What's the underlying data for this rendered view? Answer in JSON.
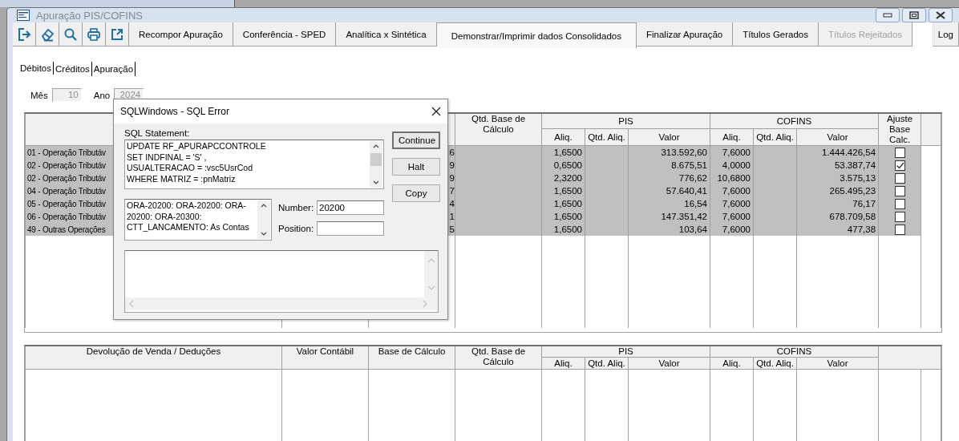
{
  "window": {
    "title": "Apuração PIS/COFINS"
  },
  "toolbar": [
    {
      "label": "Recompor Apuração",
      "selected": false,
      "disabled": false
    },
    {
      "label": "Conferência - SPED",
      "selected": false,
      "disabled": false
    },
    {
      "label": "Analítica x Sintética",
      "selected": false,
      "disabled": false
    },
    {
      "label": "Demonstrar/Imprimir dados Consolidados",
      "selected": true,
      "disabled": false
    },
    {
      "label": "Finalizar Apuração",
      "selected": false,
      "disabled": false
    },
    {
      "label": "Títulos Gerados",
      "selected": false,
      "disabled": false
    },
    {
      "label": "Títulos Rejeitados",
      "selected": false,
      "disabled": true
    }
  ],
  "log_button": "Log",
  "tabs": [
    {
      "label": "Débitos",
      "selected": true
    },
    {
      "label": "Créditos",
      "selected": false
    },
    {
      "label": "Apuração",
      "selected": false
    }
  ],
  "period": {
    "month_label": "Mês",
    "month": "10",
    "year_label": "Ano",
    "year": "2024"
  },
  "debits_table": {
    "header": {
      "qtd_base": "Qtd. Base de Cálculo",
      "pis": "PIS",
      "cofins": "COFINS",
      "pis_aliq": "Aliq.",
      "pis_qtd_aliq": "Qtd. Aliq.",
      "pis_valor": "Valor",
      "cofins_aliq": "Aliq.",
      "cofins_qtd_aliq": "Qtd. Aliq.",
      "cofins_valor": "Valor",
      "ajuste": "Ajuste Base Calc."
    },
    "rows": [
      {
        "description": "01 - Operação Tributáv",
        "base_tail": "6",
        "pis_aliq": "1,6500",
        "pis_valor": "313.592,60",
        "cofins_aliq": "7,6000",
        "cofins_valor": "1.444.426,54",
        "adjusted": false
      },
      {
        "description": "02 - Operação Tributáv",
        "base_tail": "9",
        "pis_aliq": "0,6500",
        "pis_valor": "8.675,51",
        "cofins_aliq": "4,0000",
        "cofins_valor": "53.387,74",
        "adjusted": true
      },
      {
        "description": "02 - Operação Tributáv",
        "base_tail": "9",
        "pis_aliq": "2,3200",
        "pis_valor": "776,62",
        "cofins_aliq": "10,6800",
        "cofins_valor": "3.575,13",
        "adjusted": false
      },
      {
        "description": "04 - Operação Tributáv",
        "base_tail": "7",
        "pis_aliq": "1,6500",
        "pis_valor": "57.640,41",
        "cofins_aliq": "7,6000",
        "cofins_valor": "265.495,23",
        "adjusted": false
      },
      {
        "description": "05 - Operação Tributáv",
        "base_tail": "4",
        "pis_aliq": "1,6500",
        "pis_valor": "16,54",
        "cofins_aliq": "7,6000",
        "cofins_valor": "76,17",
        "adjusted": false
      },
      {
        "description": "06 - Operação Tributáv",
        "base_tail": "1",
        "pis_aliq": "1,6500",
        "pis_valor": "147.351,42",
        "cofins_aliq": "7,6000",
        "cofins_valor": "678.709,58",
        "adjusted": false
      },
      {
        "description": "49 - Outras Operações",
        "base_tail": "5",
        "pis_aliq": "1,6500",
        "pis_valor": "103,64",
        "cofins_aliq": "7,6000",
        "cofins_valor": "477,38",
        "adjusted": false
      }
    ]
  },
  "deductions_table": {
    "header": {
      "description": "Devolução de Venda / Deduções",
      "valor_contabil": "Valor Contábil",
      "base": "Base de Cálculo",
      "qtd_base": "Qtd. Base de Cálculo",
      "pis": "PIS",
      "cofins": "COFINS",
      "pis_aliq": "Aliq.",
      "pis_qtd_aliq": "Qtd. Aliq.",
      "pis_valor": "Valor",
      "cofins_aliq": "Aliq.",
      "cofins_qtd_aliq": "Qtd. Aliq.",
      "cofins_valor": "Valor"
    }
  },
  "dialog": {
    "title": "SQLWindows - SQL Error",
    "sql_label": "SQL Statement:",
    "sql_lines": [
      "UPDATE RF_APURAPCCONTROLE",
      "SET INDFINAL = 'S' ,",
      "USUALTERACAO = :vsc5UsrCod",
      "WHERE MATRIZ = :pnMatriz"
    ],
    "error_lines": [
      "ORA-20200: ORA-20200: ORA-",
      "20200: ORA-20300:",
      "CTT_LANCAMENTO: As Contas"
    ],
    "number_label": "Number:",
    "number": "20200",
    "position_label": "Position:",
    "buttons": [
      "Continue",
      "Halt",
      "Copy"
    ]
  }
}
